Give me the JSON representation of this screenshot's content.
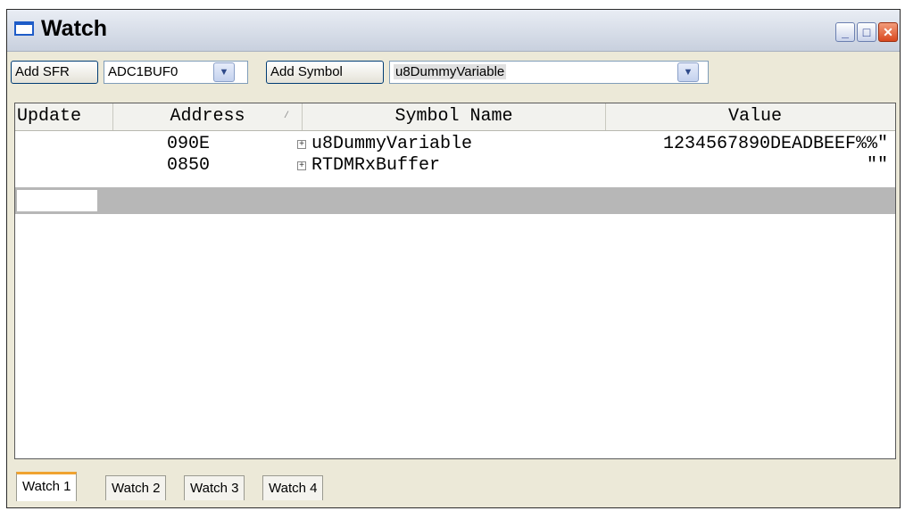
{
  "window": {
    "title": "Watch"
  },
  "toolbar": {
    "add_sfr_label": "Add SFR",
    "sfr_combo_value": "ADC1BUF0",
    "add_symbol_label": "Add Symbol",
    "symbol_combo_value": "u8DummyVariable"
  },
  "table": {
    "columns": [
      "Update",
      "Address",
      "Symbol Name",
      "Value"
    ],
    "sorted_column": "Address",
    "rows": [
      {
        "update": "",
        "address": "090E",
        "symbol": "u8DummyVariable",
        "value": "1234567890DEADBEEF%%\""
      },
      {
        "update": "",
        "address": "0850",
        "symbol": "RTDMRxBuffer",
        "value": "\"\""
      }
    ]
  },
  "tabs": [
    {
      "label": "Watch 1",
      "active": true
    },
    {
      "label": "Watch 2",
      "active": false
    },
    {
      "label": "Watch 3",
      "active": false
    },
    {
      "label": "Watch 4",
      "active": false
    }
  ],
  "colors": {
    "selected_row": "#b7b7b7",
    "active_tab_accent": "#f0a330",
    "title_icon": "#1e5cc8"
  },
  "icons": [
    "window-icon",
    "minimize-icon",
    "maximize-icon",
    "close-icon",
    "chevron-down-icon",
    "expand-icon",
    "sort-ascending-icon"
  ]
}
